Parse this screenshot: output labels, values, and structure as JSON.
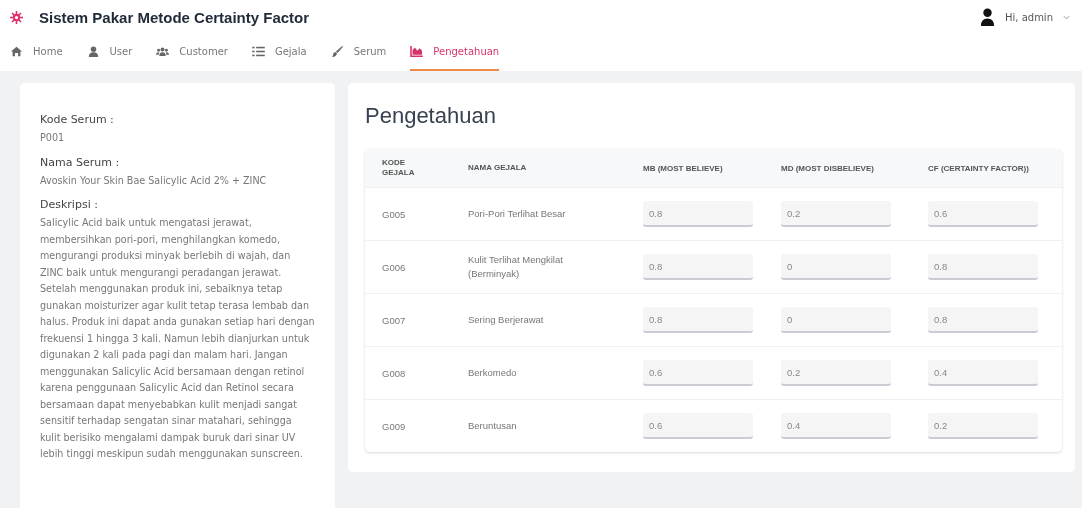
{
  "app": {
    "title": "Sistem Pakar Metode Certainty Factor",
    "user": "Hi, admin"
  },
  "nav": [
    {
      "label": "Home",
      "kind": "home",
      "selected": false
    },
    {
      "label": "User",
      "kind": "user",
      "selected": false
    },
    {
      "label": "Customer",
      "kind": "users",
      "selected": false
    },
    {
      "label": "Gejala",
      "kind": "list",
      "selected": false
    },
    {
      "label": "Serum",
      "kind": "brush",
      "selected": false
    },
    {
      "label": "Pengetahuan",
      "kind": "chart",
      "selected": true
    }
  ],
  "serum": [
    {
      "label": "Kode Serum :",
      "value": "P001"
    },
    {
      "label": "Nama Serum :",
      "value": "Avoskin Your Skin Bae Salicylic Acid 2% + ZINC"
    },
    {
      "label": "Deskripsi :",
      "value": "Salicylic Acid baik untuk mengatasi jerawat, membersihkan pori-pori, menghilangkan komedo, mengurangi produksi minyak berlebih di wajah, dan ZINC baik untuk mengurangi peradangan jerawat. Setelah menggunakan produk ini, sebaiknya tetap gunakan moisturizer agar kulit tetap terasa lembab dan halus. Produk ini dapat anda gunakan setiap hari dengan frekuensi 1 hingga 3 kali. Namun lebih dianjurkan untuk digunakan 2 kali pada pagi dan malam hari. Jangan menggunakan Salicylic Acid bersamaan dengan retinol karena penggunaan Salicylic Acid dan Retinol secara bersamaan dapat menyebabkan kulit menjadi sangat sensitif terhadap sengatan sinar matahari, sehingga kulit berisiko mengalami dampak buruk dari sinar UV lebih tinggi meskipun sudah menggunakan sunscreen."
    }
  ],
  "page_title": "Pengetahuan",
  "table": {
    "columns": [
      "KODE GEJALA",
      "NAMA GEJALA",
      "MB (MOST BELIEVE)",
      "MD (MOST DISBELIEVE)",
      "CF (CERTAINTY FACTOR))"
    ],
    "rows": [
      {
        "code": "G005",
        "name": "Pori-Pori Terlihat Besar",
        "mb": "0.8",
        "md": "0.2",
        "cf": "0.6"
      },
      {
        "code": "G006",
        "name": "Kulit Terlihat Mengkilat (Berminyak)",
        "mb": "0.8",
        "md": "0",
        "cf": "0.8"
      },
      {
        "code": "G007",
        "name": "Sering Berjerawat",
        "mb": "0.8",
        "md": "0",
        "cf": "0.8"
      },
      {
        "code": "G008",
        "name": "Berkomedo",
        "mb": "0.6",
        "md": "0.2",
        "cf": "0.4"
      },
      {
        "code": "G009",
        "name": "Beruntusan",
        "mb": "0.6",
        "md": "0.4",
        "cf": "0.2"
      }
    ]
  }
}
